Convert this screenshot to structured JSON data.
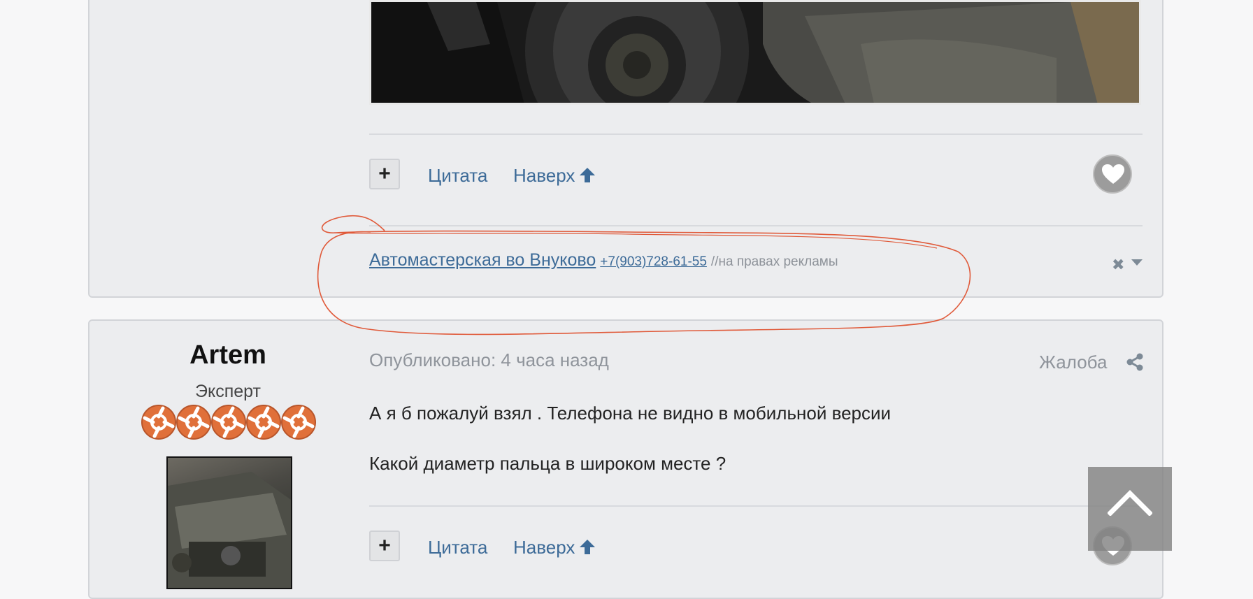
{
  "post1": {
    "footer": {
      "plus_label": "+",
      "quote_label": "Цитата",
      "top_label": "Наверх"
    }
  },
  "ad": {
    "link_text": "Автомастерская во Внуково",
    "phone": "+7(903)728-61-55",
    "note": "//на правах рекламы"
  },
  "post2": {
    "author": {
      "name": "Artem",
      "rank": "Эксперт",
      "rank_badges": 5
    },
    "published": "Опубликовано: 4 часа назад",
    "report_label": "Жалоба",
    "body": [
      "А я б пожалуй взял . Телефона не видно в мобильной версии",
      "Какой диаметр пальца в широком месте ?"
    ],
    "footer": {
      "plus_label": "+",
      "quote_label": "Цитата",
      "top_label": "Наверх"
    }
  },
  "colors": {
    "link": "#3d6b98",
    "muted": "#8f949b",
    "badge": "#e0703a",
    "annotation": "#e05a3a"
  }
}
